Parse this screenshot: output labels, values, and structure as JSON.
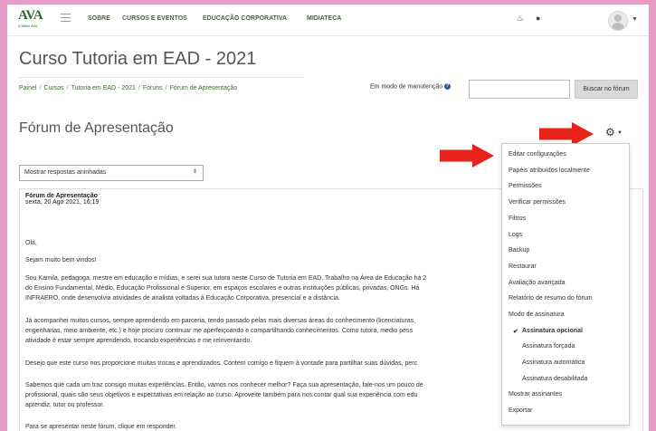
{
  "nav": {
    "logo": "AVA",
    "logo_sub": "ICMBio AVA",
    "links": [
      "SOBRE",
      "CURSOS E EVENTOS",
      "EDUCAÇÃO CORPORATIVA",
      "MIDIATECA"
    ],
    "bell_icon": "bell-icon",
    "chat_icon": "chat-icon"
  },
  "page": {
    "course_title": "Curso Tutoria em EAD - 2021",
    "breadcrumb": [
      "Painel",
      "Cursos",
      "Tutoria em EAD - 2021",
      "Fóruns",
      "Fórum de Apresentação"
    ],
    "maintenance_label": "Em modo de manutenção",
    "search_button": "Buscar no fórum",
    "forum_title": "Fórum de Apresentação",
    "display_mode": "Mostrar respostas aninhadas"
  },
  "post": {
    "title": "Fórum de Apresentação",
    "date": "sexta, 20 Ago 2021, 16:19",
    "lines": [
      "Olá,",
      "Sejam muito bem vindos!",
      "Sou Kamila, pedagoga, mestre em educação e mídias, e serei sua tutora neste Curso de Tutoria em EAD. Trabalho na Área de Educação há 2",
      "do Ensino Fundamental, Médio, Educação Profissional e Superior, em espaços escolares e outras instituições públicas, privadas, ONGs. Há",
      "INFRAERO, onde desenvolvia atividades de analista voltadas à Educação Corporativa, presencial e a distância.",
      "Já acompanhei muitos cursos, sempre aprendendo em parceria, tendo passado pelas mais diversas áreas do conhecimento (licenciaturas,",
      "engenharias, meio ambiente, etc.) e hoje procuro continuar me aperfeiçoando e compartilhando conhecimentos. Como tutora, medio pess",
      "atividade é estar sempre aprendendo, trocando experiências e me reinventando.",
      "Desejo que este curso nos proporcione muitas trocas e aprendizados. Contem comigo e fiquem à vontade para partilhar suas dúvidas, perc",
      "Sabemos que cada um traz consigo muitas experiências. Então, vamos nos conhecer melhor? Faça sua apresentação, fale-nos um pouco de",
      "profissional, quais são seus objetivos e expectativas em relação ao curso. Aproveite também para nos contar qual sua experiência com edu",
      "aprendiz, tutor ou professor.",
      "Para se apresentar neste fórum, clique em responder."
    ]
  },
  "menu": {
    "items": [
      {
        "label": "Editar configurações"
      },
      {
        "label": "Papéis atribuídos localmente"
      },
      {
        "label": "Permissões"
      },
      {
        "label": "Verificar permissões"
      },
      {
        "label": "Filtros"
      },
      {
        "label": "Logs"
      },
      {
        "label": "Backup"
      },
      {
        "label": "Restaurar"
      },
      {
        "label": "Avaliação avançada"
      },
      {
        "label": "Relatório de resumo do fórum"
      },
      {
        "label": "Modo de assinatura"
      },
      {
        "label": "Assinatura opcional"
      },
      {
        "label": "Assinatura forçada"
      },
      {
        "label": "Assinatura automática"
      },
      {
        "label": "Assinatura desabilitada"
      },
      {
        "label": "Mostrar assinantes"
      },
      {
        "label": "Exportar"
      }
    ]
  },
  "colors": {
    "background": "#e79bc7",
    "link": "#3a6e2b",
    "arrow": "#e8231b"
  }
}
